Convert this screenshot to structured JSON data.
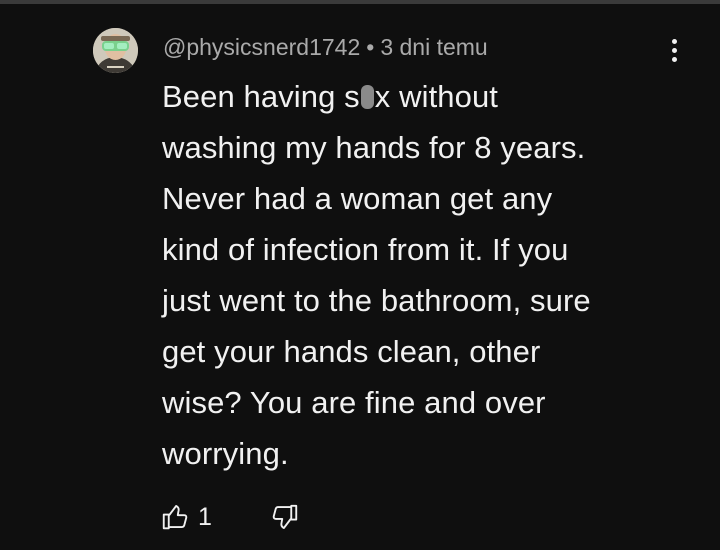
{
  "comment": {
    "author": "@physicsnerd1742",
    "separator": "•",
    "time": "3 dni temu",
    "lines": [
      {
        "pre": "Been having s",
        "censored": true,
        "post": "x without"
      },
      {
        "text": "washing my hands for 8 years."
      },
      {
        "text": "Never had a woman get any"
      },
      {
        "text": "kind of infection from it. If you"
      },
      {
        "text": "just went to the bathroom, sure"
      },
      {
        "text": "get your hands clean, other"
      },
      {
        "text": "wise? You are fine and over"
      },
      {
        "text": "worrying."
      }
    ],
    "like_count": "1"
  },
  "icons": {
    "avatar": "avatar-goggles-person",
    "more": "more-vert-icon",
    "like": "thumb-up-icon",
    "dislike": "thumb-down-icon"
  },
  "colors": {
    "background": "#0f0f0f",
    "text": "#f1f1f1",
    "meta": "#aaaaaa"
  }
}
